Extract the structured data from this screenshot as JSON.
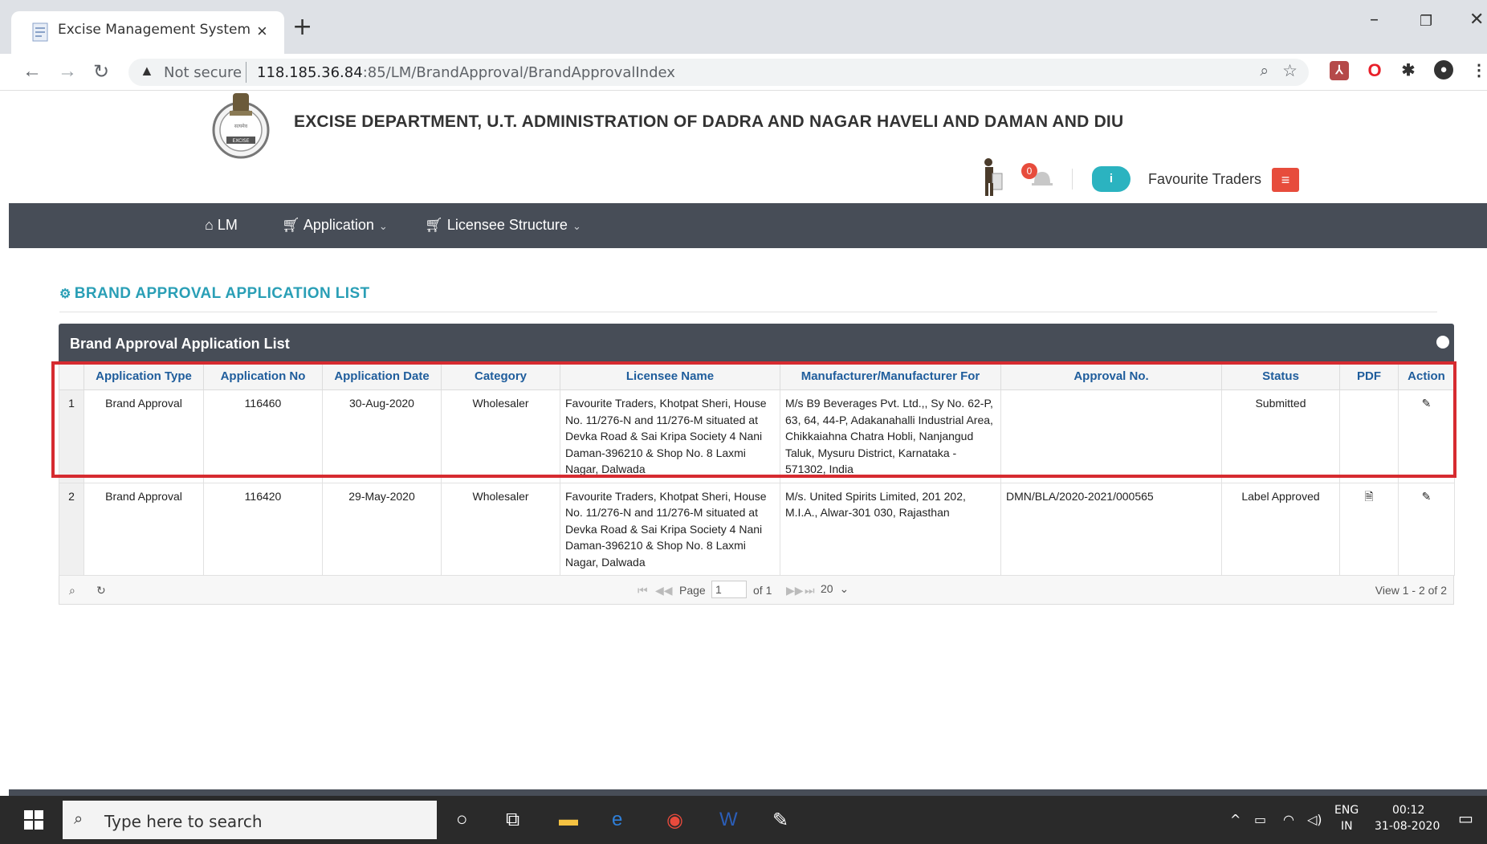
{
  "browser": {
    "tab_title": "Excise Management System",
    "tab_close": "×",
    "new_tab": "+",
    "minimize": "–",
    "restore": "❐",
    "close": "✕",
    "not_secure": "Not secure",
    "url_host": "118.185.36.84",
    "url_rest": ":85/LM/BrandApproval/BrandApprovalIndex"
  },
  "header": {
    "dept_title": "EXCISE DEPARTMENT, U.T. ADMINISTRATION OF DADRA AND NAGAR HAVELI AND DAMAN AND DIU",
    "notification_count": "0",
    "info_label": "i",
    "user_name": "Favourite Traders"
  },
  "nav": {
    "items": [
      {
        "label": "LM"
      },
      {
        "label": "Application"
      },
      {
        "label": "Licensee Structure"
      }
    ]
  },
  "section": {
    "title": "BRAND APPROVAL APPLICATION LIST"
  },
  "grid": {
    "caption": "Brand Approval Application List",
    "columns": [
      "",
      "Application Type",
      "Application No",
      "Application Date",
      "Category",
      "Licensee Name",
      "Manufacturer/Manufacturer For",
      "Approval No.",
      "Status",
      "PDF",
      "Action"
    ],
    "rows": [
      {
        "num": "1",
        "type": "Brand Approval",
        "app_no": "116460",
        "date": "30-Aug-2020",
        "category": "Wholesaler",
        "licensee": "Favourite Traders, Khotpat Sheri, House No. 11/276-N and 11/276-M situated at Devka Road & Sai Kripa Society 4 Nani Daman-396210 & Shop No. 8 Laxmi Nagar, Dalwada",
        "manufacturer": "M/s B9 Beverages Pvt. Ltd.,, Sy No. 62-P, 63, 64, 44-P, Adakanahalli Industrial Area, Chikkaiahna Chatra Hobli, Nanjangud Taluk, Mysuru District, Karnataka - 571302, India",
        "approval_no": "",
        "status": "Submitted"
      },
      {
        "num": "2",
        "type": "Brand Approval",
        "app_no": "116420",
        "date": "29-May-2020",
        "category": "Wholesaler",
        "licensee": "Favourite Traders, Khotpat Sheri, House No. 11/276-N and 11/276-M situated at Devka Road & Sai Kripa Society 4 Nani Daman-396210 & Shop No. 8 Laxmi Nagar, Dalwada",
        "manufacturer": "M/s. United Spirits Limited, 201 202, M.I.A., Alwar-301 030, Rajasthan",
        "approval_no": "DMN/BLA/2020-2021/000565",
        "status": "Label Approved"
      }
    ],
    "pager": {
      "page_label": "Page",
      "page_value": "1",
      "of_label": "of 1",
      "page_size": "20",
      "view_text": "View 1 - 2 of 2"
    }
  },
  "taskbar": {
    "search_placeholder": "Type here to search",
    "lang": "ENG",
    "region": "IN",
    "time": "00:12",
    "date": "31-08-2020"
  },
  "colors": {
    "nav_bg": "#474d57",
    "accent_teal": "#2a9fb6",
    "highlight_red": "#d62b30",
    "menu_red": "#e74c3c"
  }
}
